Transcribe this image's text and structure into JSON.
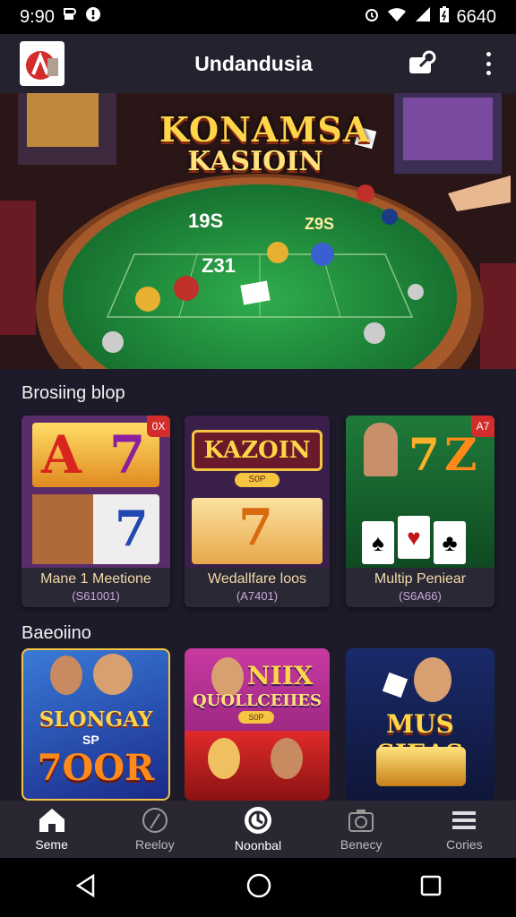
{
  "status_bar": {
    "time": "9:90",
    "carrier_icon": "signal-icon",
    "battery": "6640"
  },
  "app_bar": {
    "title": "Undandusia"
  },
  "banner": {
    "logo_line1": "KONAMSA",
    "logo_line2": "KASIOIN",
    "table_text": [
      "19S",
      "Z31",
      "Z9S"
    ]
  },
  "section1": {
    "title": "Brosiing blop",
    "cards": [
      {
        "title": "Mane 1 Meetione",
        "sub": "(S61001)",
        "badge": "0X",
        "reels": [
          "A",
          "7",
          "7"
        ]
      },
      {
        "title": "Wedallfare loos",
        "sub": "(A7401)",
        "badge": "",
        "logo": "KAZOIN",
        "chip": "S0P"
      },
      {
        "title": "Multip Peniear",
        "sub": "(S6A66)",
        "badge": "A7",
        "reels": [
          "7",
          "Z"
        ]
      }
    ]
  },
  "section2": {
    "title": "Baeoiino",
    "tiles": [
      {
        "line1": "SLONGAY",
        "line2": "7OOR",
        "chip": "SP"
      },
      {
        "line1": "NIIX",
        "line2": "QUOLLCEIIES",
        "chip": "S0P"
      },
      {
        "line1": "MUS SIEAS",
        "line2": ""
      }
    ]
  },
  "bottom_nav": [
    {
      "label": "Seme",
      "icon": "home-icon"
    },
    {
      "label": "Reeloy",
      "icon": "feather-icon"
    },
    {
      "label": "Noonbal",
      "icon": "spade-icon"
    },
    {
      "label": "Benecy",
      "icon": "camera-icon"
    },
    {
      "label": "Cories",
      "icon": "menu-icon"
    }
  ],
  "colors": {
    "accent": "#d22d2a",
    "gold": "#f5c542",
    "felt": "#1f8a3a",
    "purple": "#6a2ca0"
  }
}
